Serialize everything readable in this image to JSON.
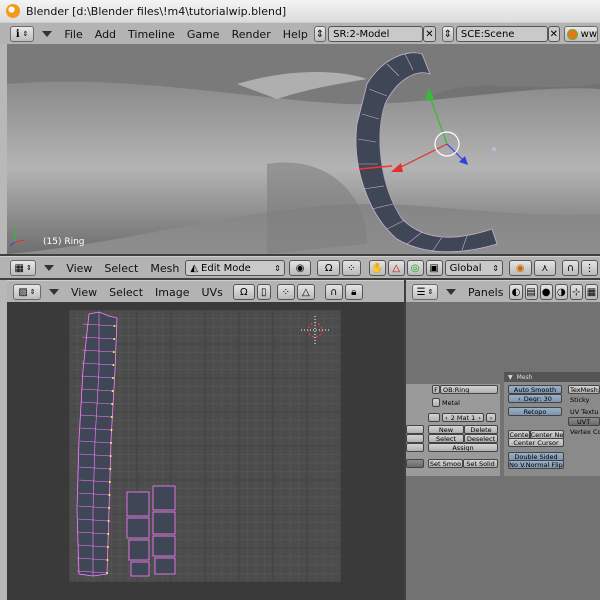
{
  "window": {
    "title": "Blender [d:\\Blender files\\!m4\\tutorialwip.blend]"
  },
  "info_header": {
    "menus": [
      "File",
      "Add",
      "Timeline",
      "Game",
      "Render",
      "Help"
    ],
    "screen": "SR:2-Model",
    "scene": "SCE:Scene",
    "right_cut": "ww"
  },
  "viewport": {
    "object_label": "(15) Ring"
  },
  "view3d_header": {
    "menus": [
      "View",
      "Select",
      "Mesh"
    ],
    "mode": "Edit Mode",
    "orientation": "Global"
  },
  "uv_header": {
    "menus": [
      "View",
      "Select",
      "Image",
      "UVs"
    ]
  },
  "buttons_header": {
    "panels_label": "Panels"
  },
  "mesh_panel": {
    "header": "Mesh",
    "auto_smooth": "Auto Smooth",
    "degr": "Degr: 30",
    "retopo": "Retopo",
    "center": "Cente",
    "center_new": "Center Ne",
    "center_cursor": "Center Cursor",
    "double_sided": "Double Sided",
    "no_normal_flip": "No V.Normal Flip",
    "tex_mesh": "TexMesh:",
    "sticky": "Sticky",
    "uv_texture": "UV Textu",
    "uv_item": "UVT",
    "vertex_color": "Vertex Co"
  },
  "link_panel": {
    "ob_field": "OB:Ring",
    "f_btn": "F",
    "material": "Metal",
    "mat_counter": "2 Mat 1",
    "new": "New",
    "delete": "Delete",
    "select": "Select",
    "deselect": "Deselect",
    "assign": "Assign",
    "set_smooth": "Set Smoo",
    "set_solid": "Set Solid"
  },
  "colors": {
    "ui_grey": "#b3b3b3",
    "uv_background": "#3a3a3a",
    "uv_grid": "#4c4c4c",
    "uv_edge": "#ff80ff",
    "uv_selected": "#ffff40",
    "axis_x": "#e03030",
    "axis_y": "#30c030",
    "axis_z": "#3040e0"
  }
}
